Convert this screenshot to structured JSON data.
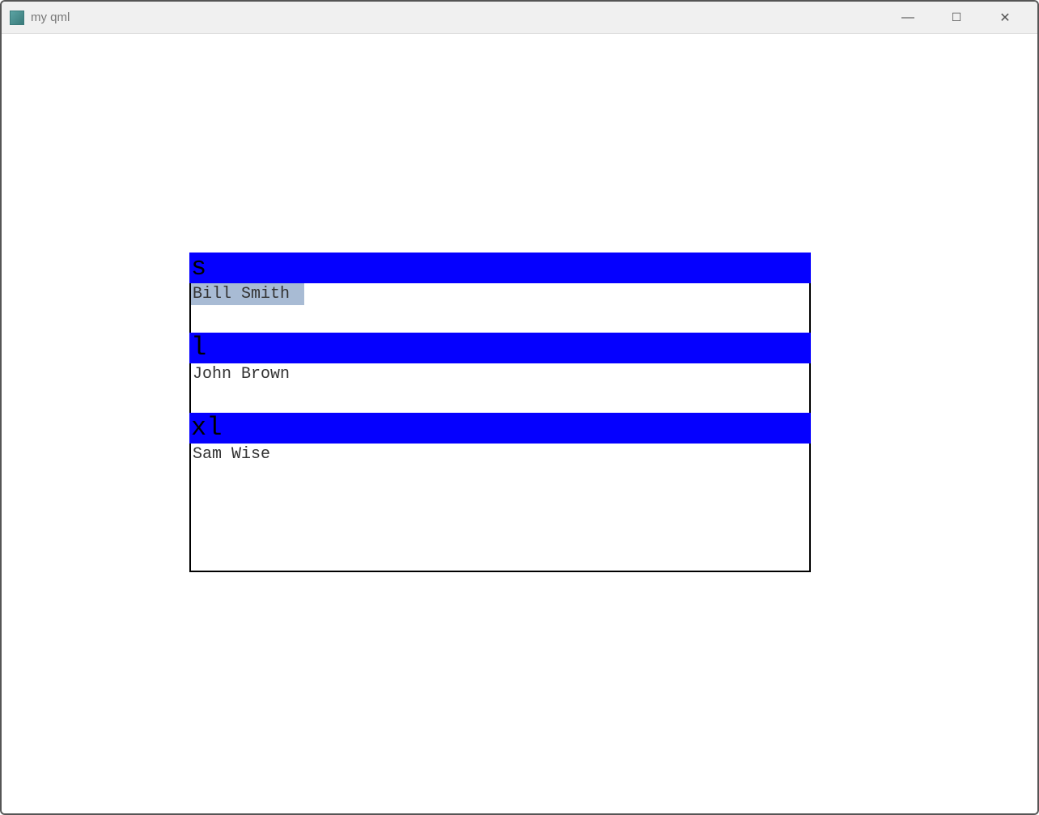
{
  "window": {
    "title": "my qml"
  },
  "list": {
    "sections": [
      {
        "header": "s",
        "name": "Bill Smith",
        "highlighted": true,
        "sizeClass": "small"
      },
      {
        "header": "l",
        "name": "John Brown",
        "highlighted": false,
        "sizeClass": "large"
      },
      {
        "header": "xl",
        "name": "Sam Wise",
        "highlighted": false,
        "sizeClass": "xlarge"
      }
    ]
  },
  "colors": {
    "headerBg": "#0500ff",
    "highlight": "#a8bbd4"
  }
}
